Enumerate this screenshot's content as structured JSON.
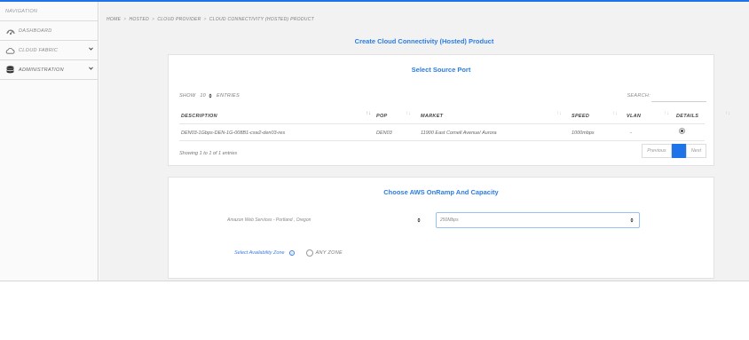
{
  "sidebar": {
    "nav_label": "NAVIGATION",
    "items": [
      {
        "label": "DASHBOARD",
        "icon": "dashboard-icon"
      },
      {
        "label": "CLOUD FABRIC",
        "icon": "cloud-icon"
      },
      {
        "label": "ADMINISTRATION",
        "icon": "database-icon"
      }
    ]
  },
  "breadcrumb": [
    "HOME",
    "HOSTED",
    "CLOUD PROVIDER",
    "CLOUD CONNECTIVITY (HOSTED) PRODUCT"
  ],
  "page_title": "Create Cloud Connectivity (Hosted) Product",
  "source_port": {
    "title": "Select Source Port",
    "show_label": "SHOW",
    "entries_value": "10",
    "entries_label": "ENTRIES",
    "search_label": "SEARCH:",
    "columns": [
      "DESCRIPTION",
      "POP",
      "MARKET",
      "SPEED",
      "VLAN",
      "DETAILS"
    ],
    "rows": [
      {
        "description": "DEN03-1Gbps-DEN-1G-008B1-csw2-den03-res",
        "pop": "DEN03",
        "market": "11900 East Cornell Avenue/ Aurora",
        "speed": "1000mbps",
        "vlan": "-"
      }
    ],
    "info": "Showing 1 to 1 of 1 entries",
    "pager": {
      "previous": "Previous",
      "next": "Next"
    }
  },
  "onramp": {
    "title": "Choose AWS OnRamp And Capacity",
    "onramp_value": "Amazon Web Services - Portland , Oregon",
    "capacity_value": "250Mbps",
    "az_label": "Select Availability Zone",
    "any_zone": "ANY ZONE"
  },
  "colors": {
    "accent": "#1e73e8",
    "title": "#2a7de1"
  }
}
